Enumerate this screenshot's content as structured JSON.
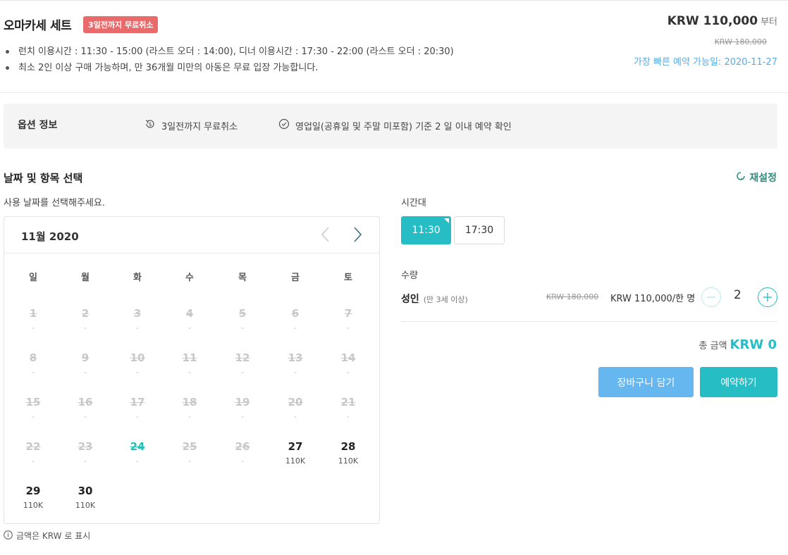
{
  "header": {
    "title": "오마카세 세트",
    "badge": "3일전까지 무료취소",
    "bullets": [
      "런치 이용시간 : 11:30 - 15:00 (라스트 오더 : 14:00), 디너 이용시간 : 17:30 - 22:00 (라스트 오더 : 20:30)",
      "최소 2인 이상 구매 가능하며, 만 36개월 미만의 아동은 무료 입장 가능합니다."
    ],
    "price": "KRW 110,000",
    "price_suffix": "부터",
    "original_price": "KRW 180,000",
    "earliest": "가장 빠른 예약 가능일: 2020-11-27"
  },
  "options": {
    "label": "옵션 정보",
    "items": [
      "3일전까지 무료취소",
      "영업일(공휴일 및 주말 미포함) 기준 2 일 이내 예약 확인"
    ]
  },
  "section": {
    "title": "날짜 및 항목 선택",
    "reset": "재설정",
    "hint": "사용 날짜를 선택해주세요."
  },
  "calendar": {
    "month": "11월 2020",
    "weekdays": [
      "일",
      "월",
      "화",
      "수",
      "목",
      "금",
      "토"
    ],
    "days": [
      {
        "n": "1",
        "p": "-",
        "s": "dis"
      },
      {
        "n": "2",
        "p": "-",
        "s": "dis"
      },
      {
        "n": "3",
        "p": "-",
        "s": "dis"
      },
      {
        "n": "4",
        "p": "-",
        "s": "dis"
      },
      {
        "n": "5",
        "p": "-",
        "s": "dis"
      },
      {
        "n": "6",
        "p": "-",
        "s": "dis"
      },
      {
        "n": "7",
        "p": "-",
        "s": "dis"
      },
      {
        "n": "8",
        "p": "-",
        "s": "dis"
      },
      {
        "n": "9",
        "p": "-",
        "s": "dis"
      },
      {
        "n": "10",
        "p": "-",
        "s": "dis"
      },
      {
        "n": "11",
        "p": "-",
        "s": "dis"
      },
      {
        "n": "12",
        "p": "-",
        "s": "dis"
      },
      {
        "n": "13",
        "p": "-",
        "s": "dis"
      },
      {
        "n": "14",
        "p": "-",
        "s": "dis"
      },
      {
        "n": "15",
        "p": "-",
        "s": "dis"
      },
      {
        "n": "16",
        "p": "-",
        "s": "dis"
      },
      {
        "n": "17",
        "p": "-",
        "s": "dis"
      },
      {
        "n": "18",
        "p": "-",
        "s": "dis"
      },
      {
        "n": "19",
        "p": "-",
        "s": "dis"
      },
      {
        "n": "20",
        "p": "-",
        "s": "dis"
      },
      {
        "n": "21",
        "p": "-",
        "s": "dis"
      },
      {
        "n": "22",
        "p": "-",
        "s": "dis"
      },
      {
        "n": "23",
        "p": "-",
        "s": "dis"
      },
      {
        "n": "24",
        "p": "-",
        "s": "today"
      },
      {
        "n": "25",
        "p": "-",
        "s": "dis"
      },
      {
        "n": "26",
        "p": "-",
        "s": "dis"
      },
      {
        "n": "27",
        "p": "110K",
        "s": "av"
      },
      {
        "n": "28",
        "p": "110K",
        "s": "av"
      },
      {
        "n": "29",
        "p": "110K",
        "s": "av"
      },
      {
        "n": "30",
        "p": "110K",
        "s": "av"
      }
    ],
    "note": "금액은 KRW 로 표시"
  },
  "timeslot": {
    "label": "시간대",
    "slots": [
      "11:30",
      "17:30"
    ],
    "selected": "11:30"
  },
  "quantity": {
    "label": "수량",
    "type": "성인",
    "type_sub": "(만 3세 이상)",
    "old_price": "KRW 180,000",
    "unit_price": "KRW 110,000/한 명",
    "value": "2"
  },
  "total": {
    "label": "총 금액",
    "amount": "KRW 0"
  },
  "buttons": {
    "cart": "장바구니 담기",
    "book": "예약하기"
  },
  "colors": {
    "accent": "#26bdc5",
    "cart": "#66b6ef",
    "badge": "#e96a6a",
    "earliest": "#5aaae0"
  }
}
